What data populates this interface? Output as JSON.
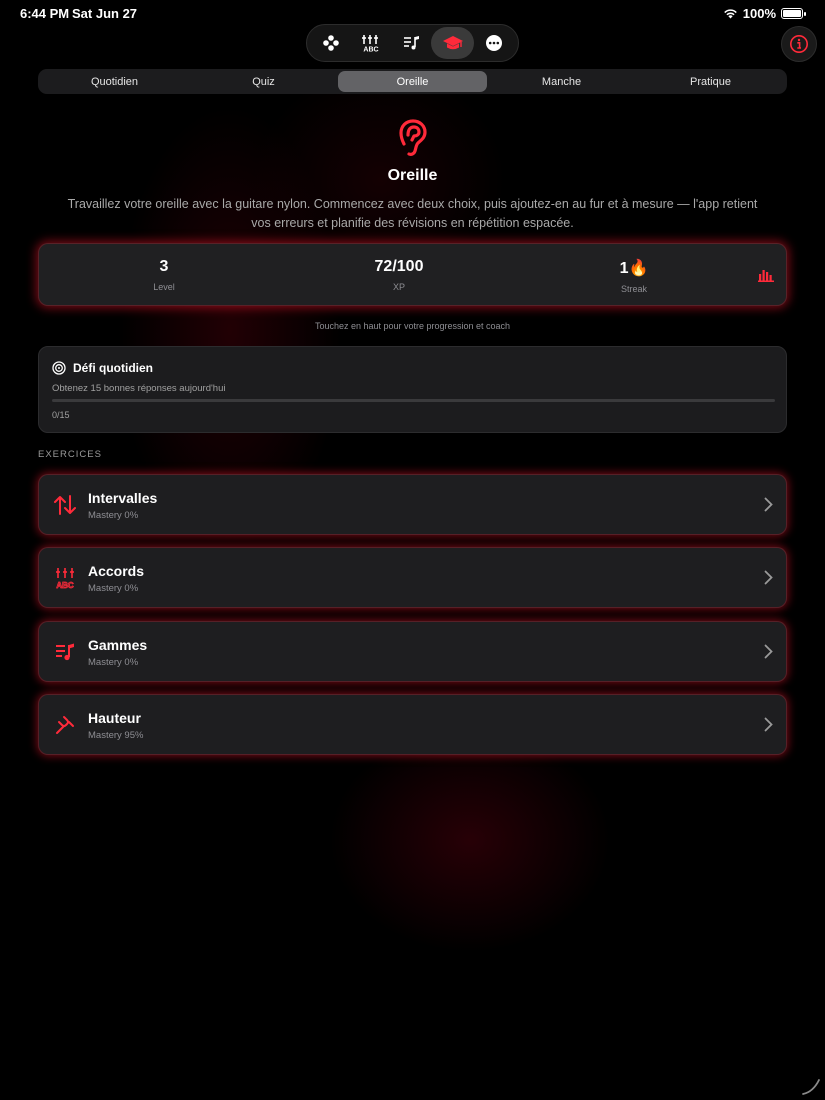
{
  "status": {
    "time": "6:44 PM",
    "date": "Sat Jun 27",
    "battery": "100%"
  },
  "top_nav": {
    "icons": [
      "gamepad-icon",
      "chords-icon",
      "scales-icon",
      "graduation-cap-icon",
      "more-icon"
    ],
    "active": "graduation-cap-icon"
  },
  "tabs": [
    {
      "label": "Quotidien"
    },
    {
      "label": "Quiz"
    },
    {
      "label": "Oreille",
      "active": true
    },
    {
      "label": "Manche"
    },
    {
      "label": "Pratique"
    }
  ],
  "hero": {
    "icon": "ear-icon",
    "title": "Oreille",
    "description": "Travaillez votre oreille avec la guitare nylon. Commencez avec deux choix, puis ajoutez-en au fur et à mesure — l'app retient vos erreurs et planifie des révisions en répétition espacée."
  },
  "stats": {
    "level": {
      "value": "3",
      "label": "Level"
    },
    "xp": {
      "value": "72/100",
      "label": "XP"
    },
    "streak": {
      "value": "1🔥",
      "label": "Streak"
    }
  },
  "hint": "Touchez en haut pour votre progression et coach",
  "challenge": {
    "title": "Défi quotidien",
    "subtitle": "Obtenez 15 bonnes réponses aujourd'hui",
    "count": "0/15",
    "progress": 0
  },
  "section_header": "EXERCICES",
  "exercises": [
    {
      "title": "Intervalles",
      "subtitle": "Mastery 0%",
      "icon": "arrows-up-down-icon"
    },
    {
      "title": "Accords",
      "subtitle": "Mastery 0%",
      "icon": "chords-icon"
    },
    {
      "title": "Gammes",
      "subtitle": "Mastery 0%",
      "icon": "scales-icon"
    },
    {
      "title": "Hauteur",
      "subtitle": "Mastery 95%",
      "icon": "tuning-fork-icon"
    }
  ],
  "colors": {
    "accent": "#ff2a3a",
    "background": "#000000",
    "card": "#1e1e20"
  }
}
